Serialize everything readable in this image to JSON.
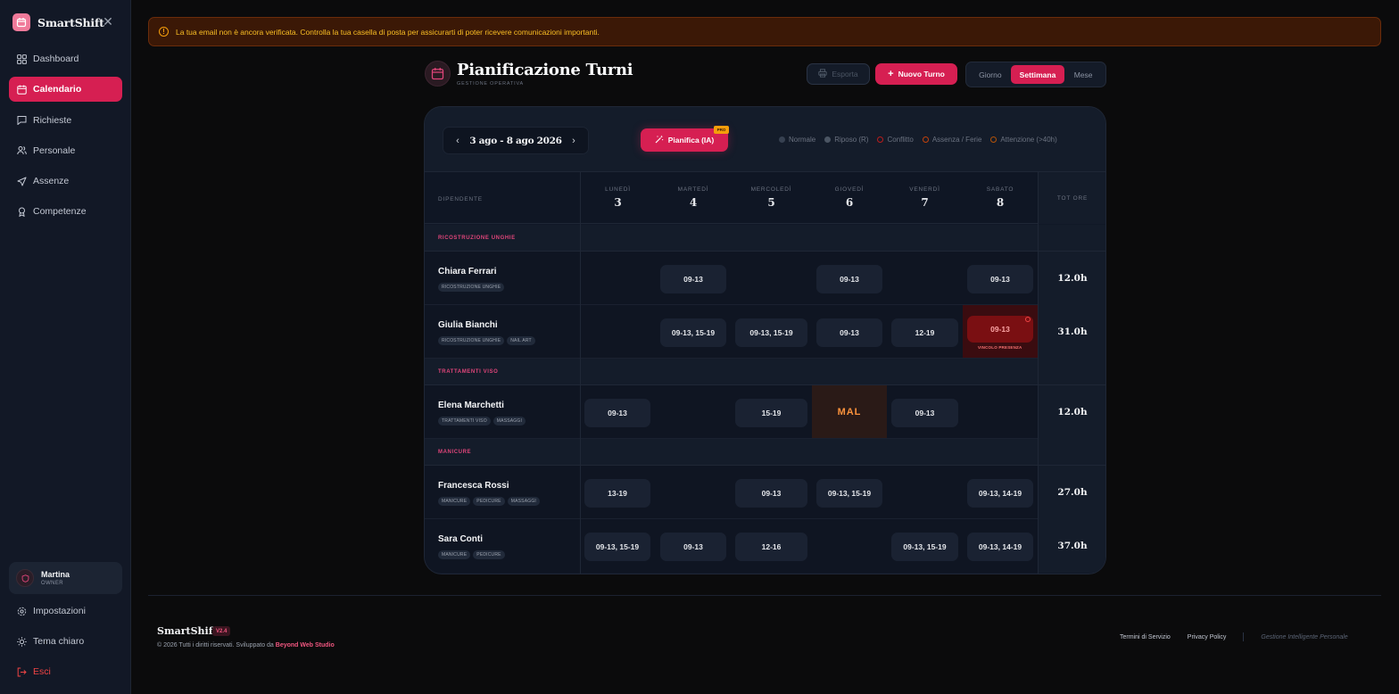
{
  "app": {
    "name": "SmartShift"
  },
  "sidebar": {
    "items": [
      {
        "label": "Dashboard",
        "icon": "grid-icon"
      },
      {
        "label": "Calendario",
        "icon": "calendar-icon"
      },
      {
        "label": "Richieste",
        "icon": "message-icon"
      },
      {
        "label": "Personale",
        "icon": "users-icon"
      },
      {
        "label": "Assenze",
        "icon": "plane-icon"
      },
      {
        "label": "Competenze",
        "icon": "award-icon"
      }
    ],
    "active": "Calendario",
    "user": {
      "name": "Martina",
      "role": "OWNER"
    },
    "bottom": [
      {
        "label": "Impostazioni",
        "icon": "gear-icon"
      },
      {
        "label": "Tema chiaro",
        "icon": "sun-icon"
      },
      {
        "label": "Esci",
        "icon": "logout-icon"
      }
    ]
  },
  "alert": {
    "text": "La tua email non è ancora verificata. Controlla la tua casella di posta per assicurarti di poter ricevere comunicazioni importanti."
  },
  "header": {
    "title": "Pianificazione Turni",
    "subtitle": "GESTIONE OPERATIVA",
    "export_label": "Esporta",
    "new_label": "Nuovo Turno",
    "views": [
      "Giorno",
      "Settimana",
      "Mese"
    ],
    "active_view": "Settimana"
  },
  "toolbar": {
    "week_range": "3 ago - 8 ago 2026",
    "ai_label": "Pianifica (IA)",
    "pro_badge": "PRO",
    "legend": [
      {
        "label": "Normale",
        "color": "#374151"
      },
      {
        "label": "Riposo (R)",
        "color": "#4b5563"
      },
      {
        "label": "Conflitto",
        "color": "#7f1d1d"
      },
      {
        "label": "Assenza / Ferie",
        "color": "#7c2d12"
      },
      {
        "label": "Attenzione (>40h)",
        "color": "#78350f"
      }
    ]
  },
  "grid": {
    "employee_header": "DIPENDENTE",
    "total_header": "TOT ORE",
    "days": [
      {
        "name": "LUNEDÌ",
        "num": "3"
      },
      {
        "name": "MARTEDÌ",
        "num": "4"
      },
      {
        "name": "MERCOLEDÌ",
        "num": "5"
      },
      {
        "name": "GIOVEDÌ",
        "num": "6"
      },
      {
        "name": "VENERDÌ",
        "num": "7"
      },
      {
        "name": "SABATO",
        "num": "8"
      }
    ],
    "groups": [
      {
        "label": "RICOSTRUZIONE UNGHIE",
        "employees": [
          {
            "name": "Chiara Ferrari",
            "tags": [
              "RICOSTRUZIONE UNGHIE"
            ],
            "shifts": [
              "",
              "09-13",
              "",
              "09-13",
              "",
              "09-13"
            ],
            "total": "12.0h"
          },
          {
            "name": "Giulia Bianchi",
            "tags": [
              "RICOSTRUZIONE UNGHIE",
              "NAIL ART"
            ],
            "shifts": [
              "",
              "09-13, 15-19",
              "09-13, 15-19",
              "09-13",
              "12-19",
              "09-13"
            ],
            "conflict_note": "VINCOLO PRESENZA",
            "total": "31.0h"
          }
        ]
      },
      {
        "label": "TRATTAMENTI VISO",
        "employees": [
          {
            "name": "Elena Marchetti",
            "tags": [
              "TRATTAMENTI VISO",
              "MASSAGGI"
            ],
            "shifts": [
              "09-13",
              "",
              "15-19",
              "MAL",
              "09-13",
              ""
            ],
            "total": "12.0h"
          }
        ]
      },
      {
        "label": "MANICURE",
        "employees": [
          {
            "name": "Francesca Rossi",
            "tags": [
              "MANICURE",
              "PEDICURE",
              "MASSAGGI"
            ],
            "shifts": [
              "13-19",
              "",
              "09-13",
              "09-13, 15-19",
              "",
              "09-13, 14-19"
            ],
            "total": "27.0h"
          },
          {
            "name": "Sara Conti",
            "tags": [
              "MANICURE",
              "PEDICURE"
            ],
            "shifts": [
              "09-13, 15-19",
              "09-13",
              "12-16",
              "",
              "09-13, 15-19",
              "09-13, 14-19"
            ],
            "total": "37.0h"
          }
        ]
      }
    ]
  },
  "footer": {
    "brand": "SmartShift",
    "version": "V2.4",
    "copyright": "© 2026 Tutti i diritti riservati. Sviluppato da ",
    "studio": "Beyond Web Studio",
    "links": [
      "Termini di Servizio",
      "Privacy Policy"
    ],
    "tagline": "Gestione Intelligente Personale"
  }
}
